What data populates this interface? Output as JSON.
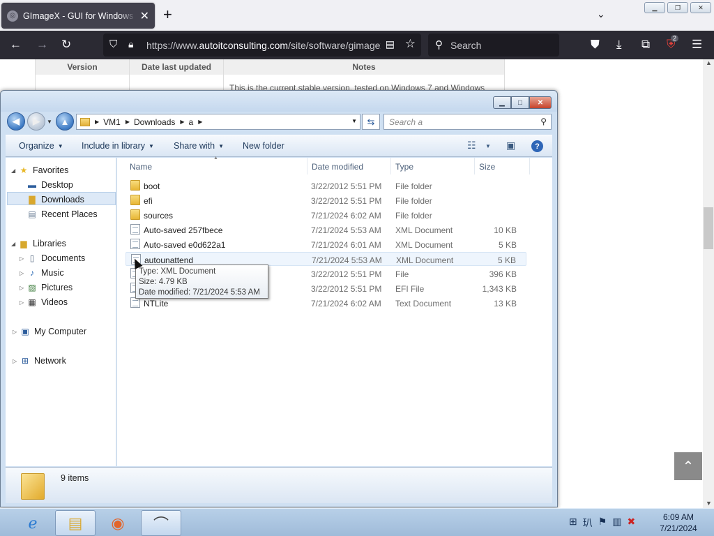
{
  "browser": {
    "tab_title": "GImageX - GUI for Windows Imaging",
    "url_prefix": "https://www.",
    "url_domain": "autoitconsulting.com",
    "url_path": "/site/software/gimagex/",
    "search_placeholder": "Search",
    "extension_badge": "2"
  },
  "webpage": {
    "columns": [
      "Version",
      "Date last updated",
      "Notes"
    ],
    "notes_text": "This is the current stable version, tested on Windows 7 and Windows"
  },
  "explorer": {
    "breadcrumb": [
      "VM1",
      "Downloads",
      "a"
    ],
    "search_placeholder": "Search a",
    "toolbar": {
      "organize": "Organize",
      "include_in_library": "Include in library",
      "share_with": "Share with",
      "new_folder": "New folder"
    },
    "nav": {
      "favorites": "Favorites",
      "desktop": "Desktop",
      "downloads": "Downloads",
      "recent_places": "Recent Places",
      "libraries": "Libraries",
      "documents": "Documents",
      "music": "Music",
      "pictures": "Pictures",
      "videos": "Videos",
      "my_computer": "My Computer",
      "network": "Network"
    },
    "columns": {
      "name": "Name",
      "date": "Date modified",
      "type": "Type",
      "size": "Size"
    },
    "files": [
      {
        "name": "boot",
        "date": "3/22/2012 5:51 PM",
        "type": "File folder",
        "size": "",
        "icon": "folder"
      },
      {
        "name": "efi",
        "date": "3/22/2012 5:51 PM",
        "type": "File folder",
        "size": "",
        "icon": "folder"
      },
      {
        "name": "sources",
        "date": "7/21/2024 6:02 AM",
        "type": "File folder",
        "size": "",
        "icon": "folder"
      },
      {
        "name": "Auto-saved 257fbece",
        "date": "7/21/2024 5:53 AM",
        "type": "XML Document",
        "size": "10 KB",
        "icon": "doc"
      },
      {
        "name": "Auto-saved e0d622a1",
        "date": "7/21/2024 6:01 AM",
        "type": "XML Document",
        "size": "5 KB",
        "icon": "doc"
      },
      {
        "name": "autounattend",
        "date": "7/21/2024 5:53 AM",
        "type": "XML Document",
        "size": "5 KB",
        "icon": "doc"
      },
      {
        "name": "",
        "date": "3/22/2012 5:51 PM",
        "type": "File",
        "size": "396 KB",
        "icon": "doc"
      },
      {
        "name": "",
        "date": "3/22/2012 5:51 PM",
        "type": "EFI File",
        "size": "1,343 KB",
        "icon": "doc"
      },
      {
        "name": "NTLite",
        "date": "7/21/2024 6:02 AM",
        "type": "Text Document",
        "size": "13 KB",
        "icon": "doc"
      }
    ],
    "tooltip": {
      "type": "Type: XML Document",
      "size": "Size: 4.79 KB",
      "date": "Date modified: 7/21/2024 5:53 AM"
    },
    "item_count": "9 items"
  },
  "taskbar": {
    "time": "6:09 AM",
    "date": "7/21/2024"
  }
}
